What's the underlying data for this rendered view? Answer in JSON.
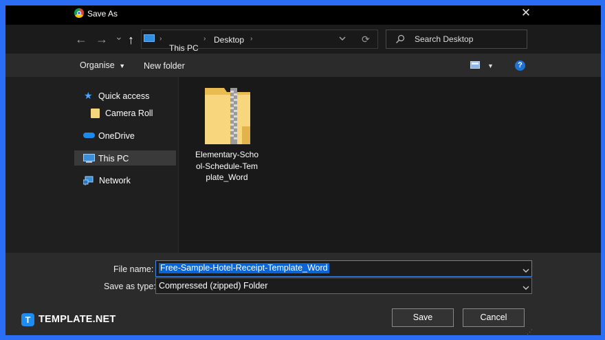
{
  "window": {
    "title": "Save As",
    "close_glyph": "✕"
  },
  "nav": {
    "back_glyph": "←",
    "forward_glyph": "→",
    "recent_glyph": "⌄",
    "up_glyph": "↑",
    "breadcrumb": [
      "This PC",
      "Desktop"
    ],
    "refresh_glyph": "⟳",
    "search_placeholder": "Search Desktop"
  },
  "toolbar": {
    "organise_label": "Organise",
    "new_folder_label": "New folder",
    "help_glyph": "?"
  },
  "sidebar": {
    "items": [
      {
        "label": "Quick access",
        "icon": "star-icon"
      },
      {
        "label": "Camera Roll",
        "icon": "folder-icon"
      },
      {
        "label": "OneDrive",
        "icon": "cloud-icon"
      },
      {
        "label": "This PC",
        "icon": "computer-icon",
        "selected": true
      },
      {
        "label": "Network",
        "icon": "network-icon"
      }
    ]
  },
  "files": [
    {
      "name_lines": [
        "Elementary-Scho",
        "ol-Schedule-Tem",
        "plate_Word"
      ],
      "icon": "zip-folder-icon"
    }
  ],
  "form": {
    "file_name_label": "File name:",
    "file_name_value": "Free-Sample-Hotel-Receipt-Template_Word",
    "save_type_label": "Save as type:",
    "save_type_value": "Compressed (zipped) Folder"
  },
  "buttons": {
    "save": "Save",
    "cancel": "Cancel"
  },
  "brand": {
    "logo_letter": "T",
    "name": "TEMPLATE.NET"
  },
  "colors": {
    "accent": "#2a6ef5",
    "selection": "#0a64d6",
    "folder": "#f5d67a"
  }
}
